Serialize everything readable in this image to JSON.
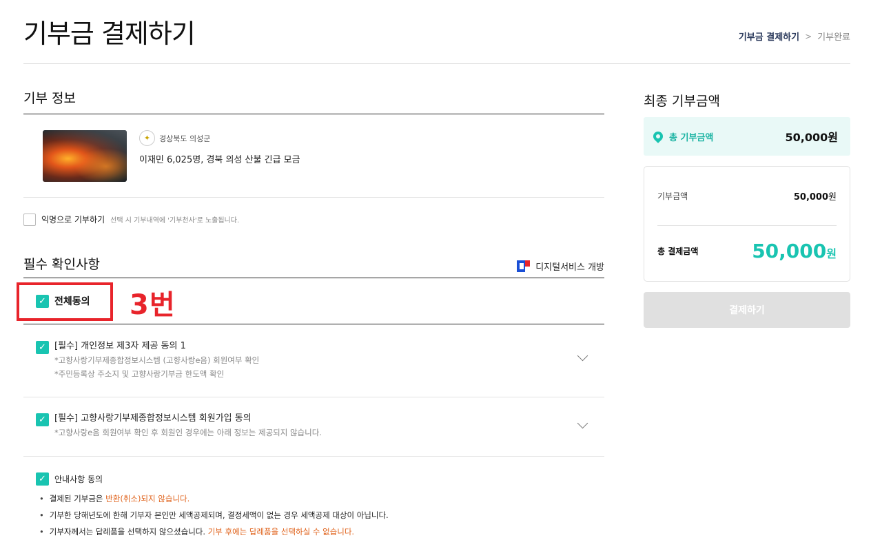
{
  "header": {
    "title": "기부금 결제하기",
    "steps": [
      {
        "label": "기부금 결제하기",
        "current": true
      },
      {
        "label": "기부완료",
        "current": false
      }
    ],
    "step_separator": ">"
  },
  "donation_info": {
    "section_title": "기부 정보",
    "region": "경상북도 의성군",
    "title": "이재민 6,025명, 경북 의성 산불 긴급 모금",
    "anonymous_label": "익명으로 기부하기",
    "anonymous_desc": "선택 시 기부내역에 '기부천사'로 노출됩니다.",
    "anonymous_checked": false
  },
  "required": {
    "section_title": "필수 확인사항",
    "digital_service_label": "디지털서비스 개방",
    "all_agree_label": "전체동의",
    "all_agree_checked": true,
    "annotation": "3번",
    "terms": [
      {
        "title": "[필수] 개인정보 제3자 제공 동의 1",
        "sub": [
          "*고향사랑기부제종합정보시스템 (고향사랑e음) 회원여부 확인",
          "*주민등록상 주소지 및 고향사랑기부금 한도액 확인"
        ],
        "checked": true
      },
      {
        "title": "[필수] 고향사랑기부제종합정보시스템 회원가입 동의",
        "sub": [
          "*고향사랑e음 회원여부 확인 후 회원인 경우에는 아래 정보는 제공되지 않습니다."
        ],
        "checked": true
      }
    ],
    "notice": {
      "title": "안내사항 동의",
      "checked": true,
      "items": [
        {
          "text": "결제된 기부금은 ",
          "highlight": "반환(취소)되지 않습니다."
        },
        {
          "text": "기부한 당해년도에 한해 기부자 본인만 세액공제되며, 결정세액이 없는 경우 세액공제 대상이 아닙니다.",
          "highlight": ""
        },
        {
          "text": "기부자께서는 답례품을 선택하지 않으셨습니다. ",
          "highlight": "기부 후에는 답례품을 선택하실 수 없습니다."
        }
      ]
    }
  },
  "summary": {
    "section_title": "최종 기부금액",
    "total_label": "총 기부금액",
    "total_value": "50,000원",
    "donation_label": "기부금액",
    "donation_amount": "50,000",
    "donation_unit": "원",
    "payment_label": "총 결제금액",
    "payment_amount": "50,000",
    "payment_unit": "원",
    "pay_button": "결제하기"
  },
  "colors": {
    "accent": "#19c4b1",
    "highlight": "#e0631c",
    "annotation": "#e8242b"
  }
}
